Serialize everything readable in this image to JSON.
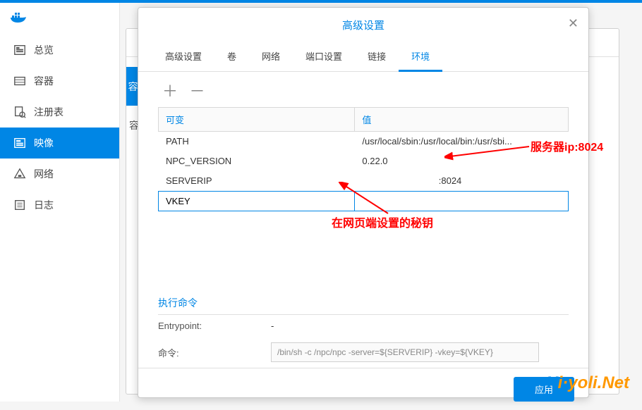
{
  "sidebar": {
    "items": [
      {
        "label": "总览",
        "icon": "overview"
      },
      {
        "label": "容器",
        "icon": "container"
      },
      {
        "label": "注册表",
        "icon": "registry"
      },
      {
        "label": "映像",
        "icon": "image"
      },
      {
        "label": "网络",
        "icon": "network"
      },
      {
        "label": "日志",
        "icon": "log"
      }
    ],
    "active_index": 3
  },
  "modal": {
    "title": "高级设置",
    "tabs": [
      "高级设置",
      "卷",
      "网络",
      "端口设置",
      "链接",
      "环境"
    ],
    "active_tab": 5,
    "table": {
      "header_key": "可变",
      "header_val": "值",
      "rows": [
        {
          "key": "PATH",
          "val": "/usr/local/sbin:/usr/local/bin:/usr/sbi..."
        },
        {
          "key": "NPC_VERSION",
          "val": "0.22.0"
        },
        {
          "key": "SERVERIP",
          "val": "                              :8024"
        },
        {
          "key": "VKEY",
          "val": ""
        }
      ],
      "selected_row": 3
    },
    "exec_title": "执行命令",
    "entrypoint_label": "Entrypoint:",
    "entrypoint_val": "-",
    "cmd_label": "命令:",
    "cmd_val": "/bin/sh -c /npc/npc -server=${SERVERIP} -vkey=${VKEY}",
    "apply_label": "应用"
  },
  "annotations": {
    "server_ip": "服务器ip:8024",
    "vkey_note": "在网页端设置的秘钥"
  },
  "watermark": {
    "brand_x": "X",
    "brand_rest": "i·yoli.Net"
  },
  "bg_label": "容"
}
